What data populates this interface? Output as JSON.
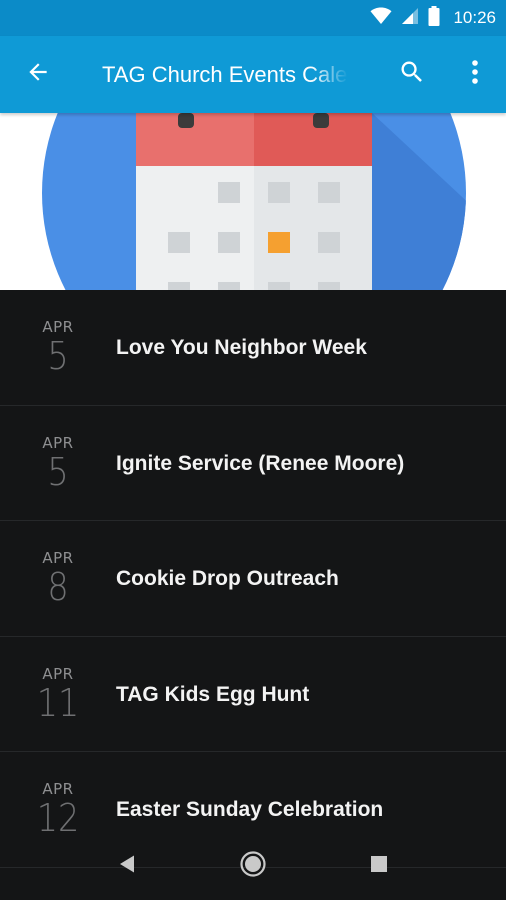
{
  "status_bar": {
    "time": "10:26",
    "icons": [
      "wifi-icon",
      "signal-icon",
      "battery-icon"
    ]
  },
  "app_bar": {
    "title": "TAG Church Events Calendar",
    "back_icon": "arrow-back-icon",
    "search_icon": "search-icon",
    "more_icon": "more-vert-icon",
    "color": "#0f9ad6"
  },
  "hero": {
    "image": "calendar-illustration",
    "circle_color": "#4a90e2",
    "header_color": "#e35d5b",
    "highlight_color": "#f5a030"
  },
  "events": [
    {
      "month": "APR",
      "day": "5",
      "title": "Love You Neighbor Week"
    },
    {
      "month": "APR",
      "day": "5",
      "title": "Ignite Service (Renee Moore)"
    },
    {
      "month": "APR",
      "day": "8",
      "title": "Cookie Drop Outreach"
    },
    {
      "month": "APR",
      "day": "11",
      "title": "TAG Kids Egg Hunt"
    },
    {
      "month": "APR",
      "day": "12",
      "title": "Easter Sunday Celebration"
    }
  ],
  "nav_bar": {
    "buttons": [
      "back-triangle-icon",
      "home-circle-icon",
      "recents-square-icon"
    ]
  }
}
